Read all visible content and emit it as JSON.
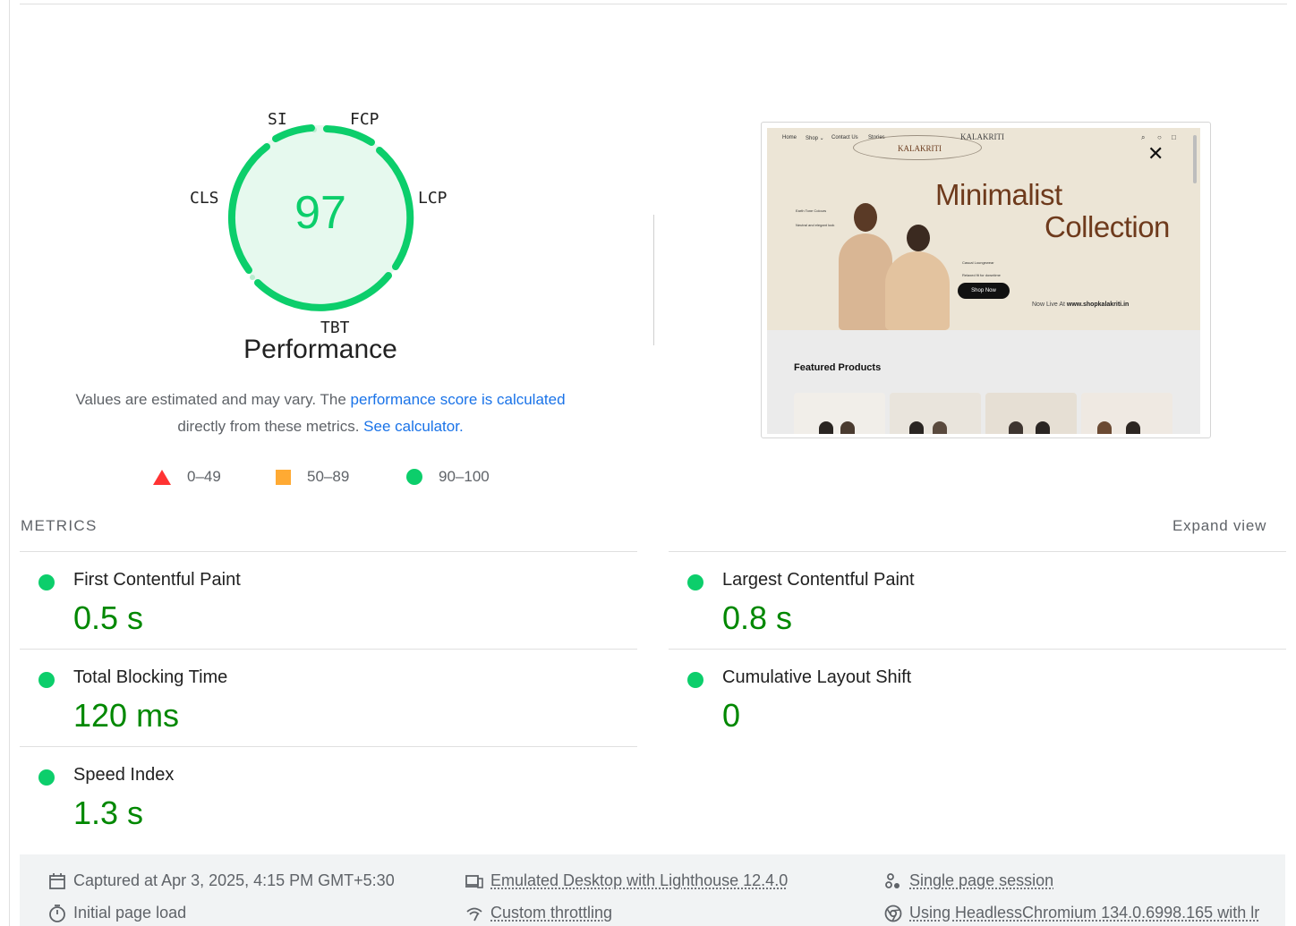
{
  "gauge": {
    "score": "97",
    "labels": {
      "si": "SI",
      "fcp": "FCP",
      "lcp": "LCP",
      "tbt": "TBT",
      "cls": "CLS"
    },
    "title": "Performance"
  },
  "description": {
    "part1": "Values are estimated and may vary. The ",
    "link1": "performance score is calculated",
    "part2": " directly from these metrics. ",
    "link2": "See calculator."
  },
  "legend": [
    {
      "range": "0–49",
      "shape": "triangle",
      "color": "#ff3333"
    },
    {
      "range": "50–89",
      "shape": "square",
      "color": "#ffaa33"
    },
    {
      "range": "90–100",
      "shape": "circle",
      "color": "#0cce6b"
    }
  ],
  "screenshot": {
    "nav": [
      "Home",
      "Shop ⌄",
      "Contact Us",
      "Stories"
    ],
    "brand": "KALAKRITI",
    "brand_top": "KALAKRITI",
    "headline_1": "Minimalist",
    "headline_2": "Collection",
    "tag_1_title": "Earth Tone Colours",
    "tag_1_body": "Neutral and elegant look",
    "tag_2_title": "Casual Loungewear",
    "tag_2_body": "Relaxed fit for downtime",
    "shop_now": "Shop Now",
    "live_prefix": "Now Live At ",
    "live_url": "www.shopkalakriti.in",
    "featured": "Featured Products"
  },
  "metrics": {
    "title": "METRICS",
    "expand": "Expand view",
    "items": [
      {
        "name": "First Contentful Paint",
        "value": "0.5 s"
      },
      {
        "name": "Largest Contentful Paint",
        "value": "0.8 s"
      },
      {
        "name": "Total Blocking Time",
        "value": "120 ms"
      },
      {
        "name": "Cumulative Layout Shift",
        "value": "0"
      },
      {
        "name": "Speed Index",
        "value": "1.3 s"
      }
    ]
  },
  "footer": {
    "captured": "Captured at Apr 3, 2025, 4:15 PM GMT+5:30",
    "emulated": "Emulated Desktop with Lighthouse 12.4.0",
    "session": "Single page session",
    "initial": "Initial page load",
    "throttling": "Custom throttling",
    "browser": "Using HeadlessChromium 134.0.6998.165 with lr"
  },
  "colors": {
    "pass": "#0cce6b",
    "pass_text": "#008800",
    "link": "#1a73e8"
  }
}
